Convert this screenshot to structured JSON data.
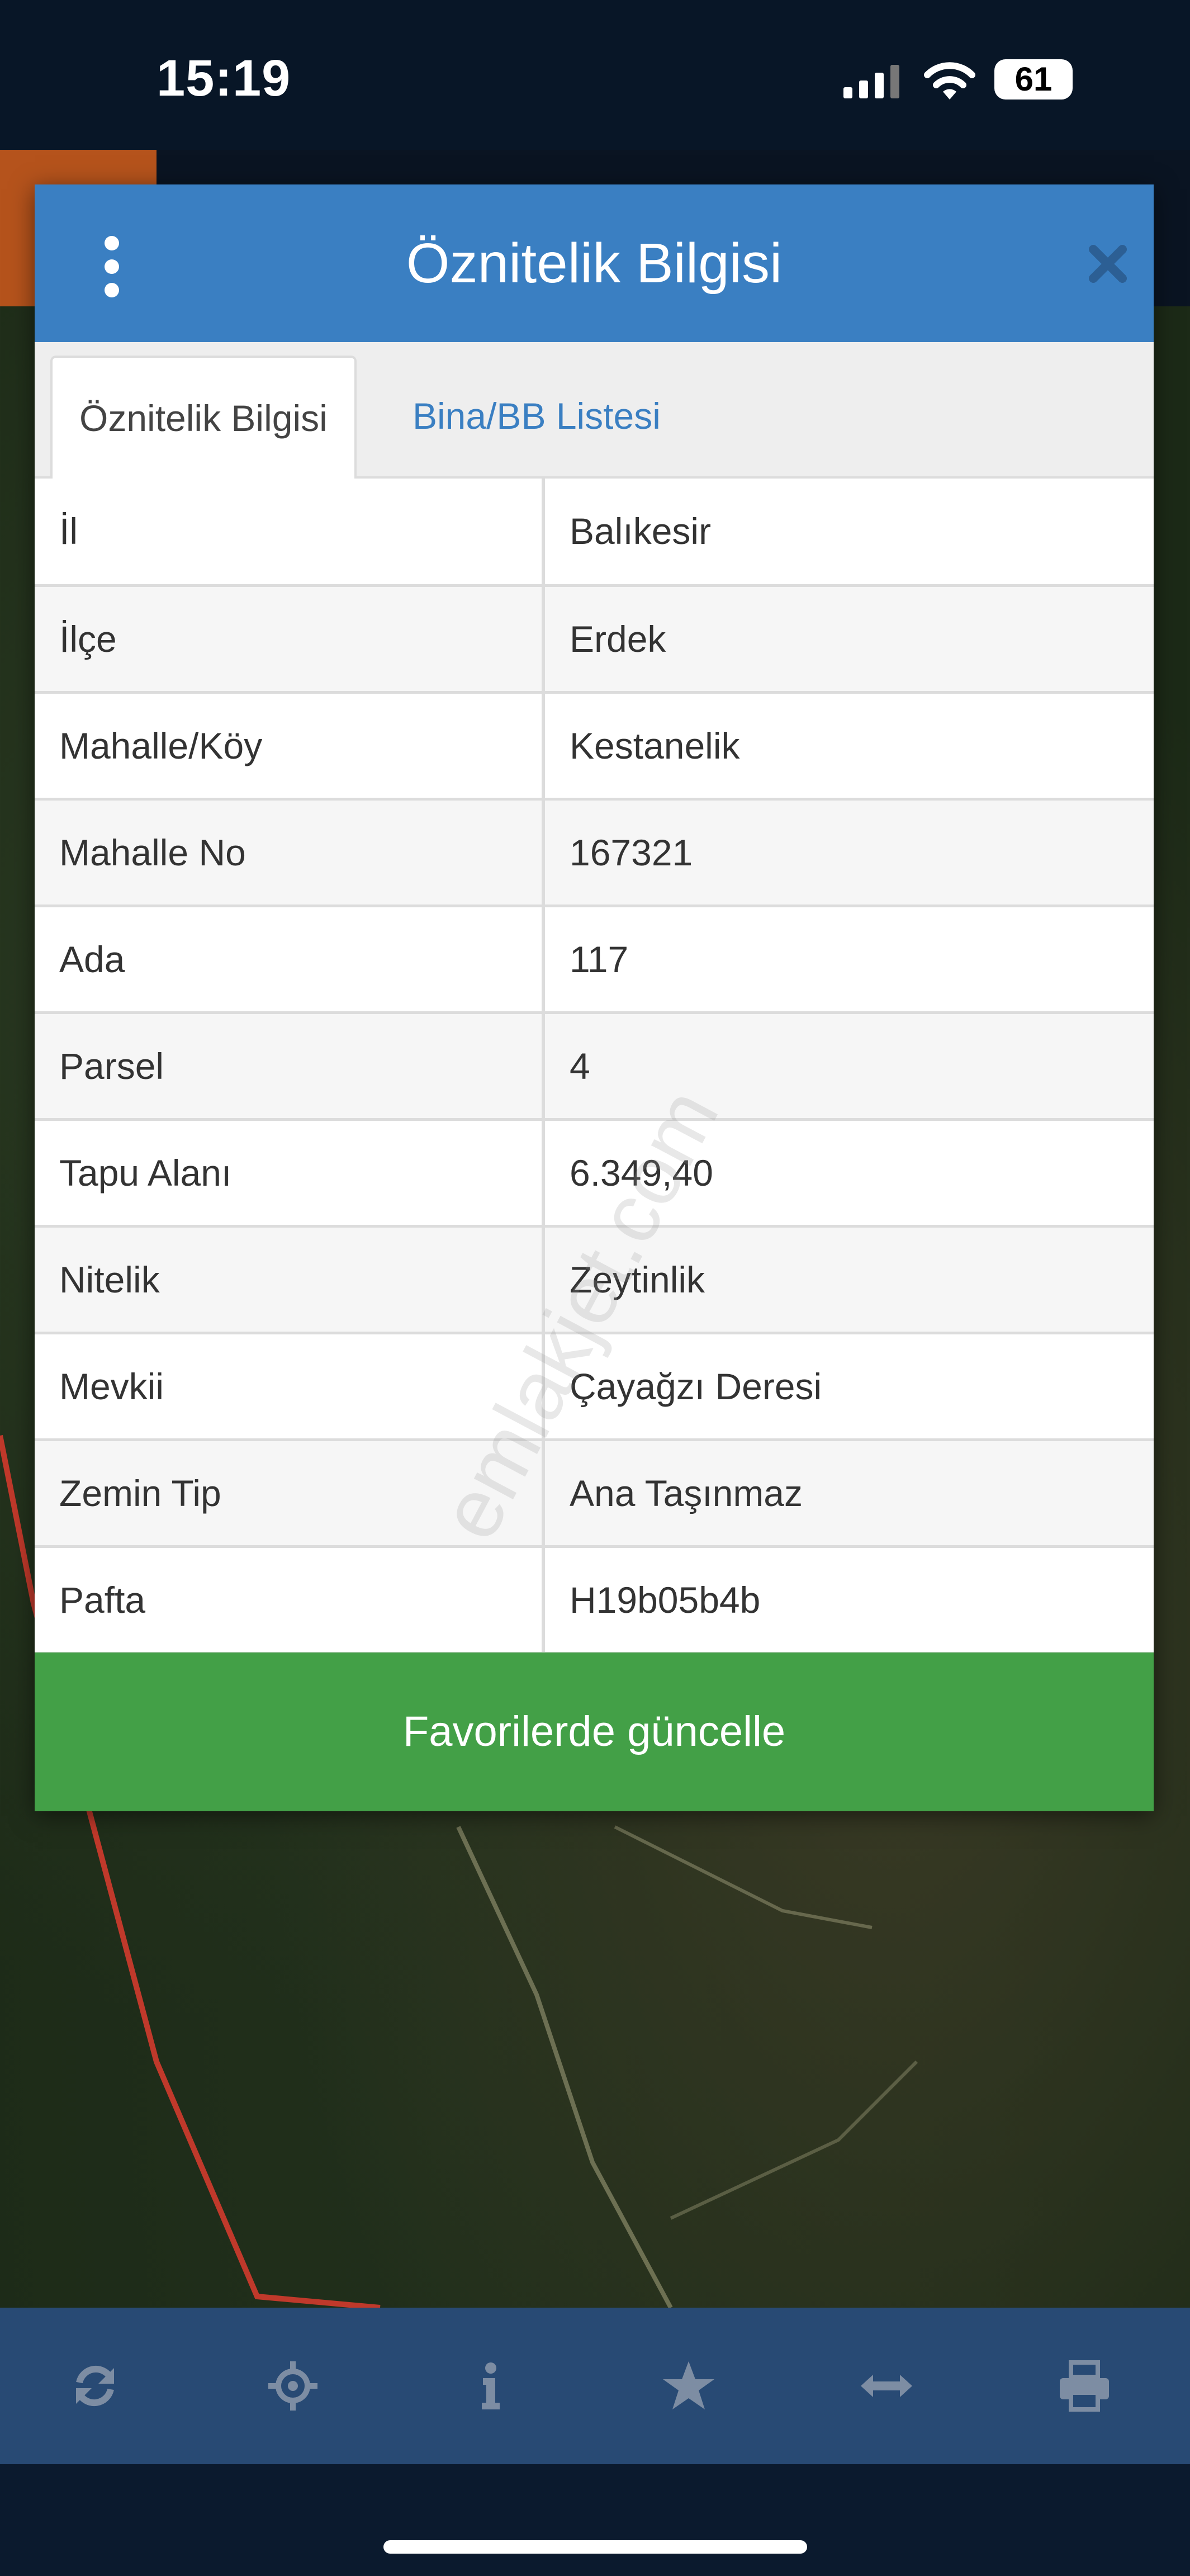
{
  "status_bar": {
    "time": "15:19",
    "battery": "61"
  },
  "modal": {
    "title": "Öznitelik Bilgisi",
    "tabs": [
      {
        "label": "Öznitelik Bilgisi",
        "active": true
      },
      {
        "label": "Bina/BB Listesi",
        "active": false
      }
    ],
    "rows": [
      {
        "key": "İl",
        "value": "Balıkesir"
      },
      {
        "key": "İlçe",
        "value": "Erdek"
      },
      {
        "key": "Mahalle/Köy",
        "value": "Kestanelik"
      },
      {
        "key": "Mahalle No",
        "value": "167321"
      },
      {
        "key": "Ada",
        "value": "117"
      },
      {
        "key": "Parsel",
        "value": "4"
      },
      {
        "key": "Tapu Alanı",
        "value": "6.349,40"
      },
      {
        "key": "Nitelik",
        "value": "Zeytinlik"
      },
      {
        "key": "Mevkii",
        "value": "Çayağzı Deresi"
      },
      {
        "key": "Zemin Tip",
        "value": "Ana Taşınmaz"
      },
      {
        "key": "Pafta",
        "value": "H19b05b4b"
      }
    ],
    "button_label": "Favorilerde güncelle"
  },
  "watermark": "emlakjet.com",
  "toolbar": {
    "icons": [
      "refresh-icon",
      "locate-icon",
      "info-icon",
      "star-icon",
      "measure-icon",
      "print-icon"
    ]
  },
  "colors": {
    "header": "#3a7fc2",
    "button": "#43a047",
    "toolbar": "#284a74",
    "parcel_line": "#c0392b"
  }
}
